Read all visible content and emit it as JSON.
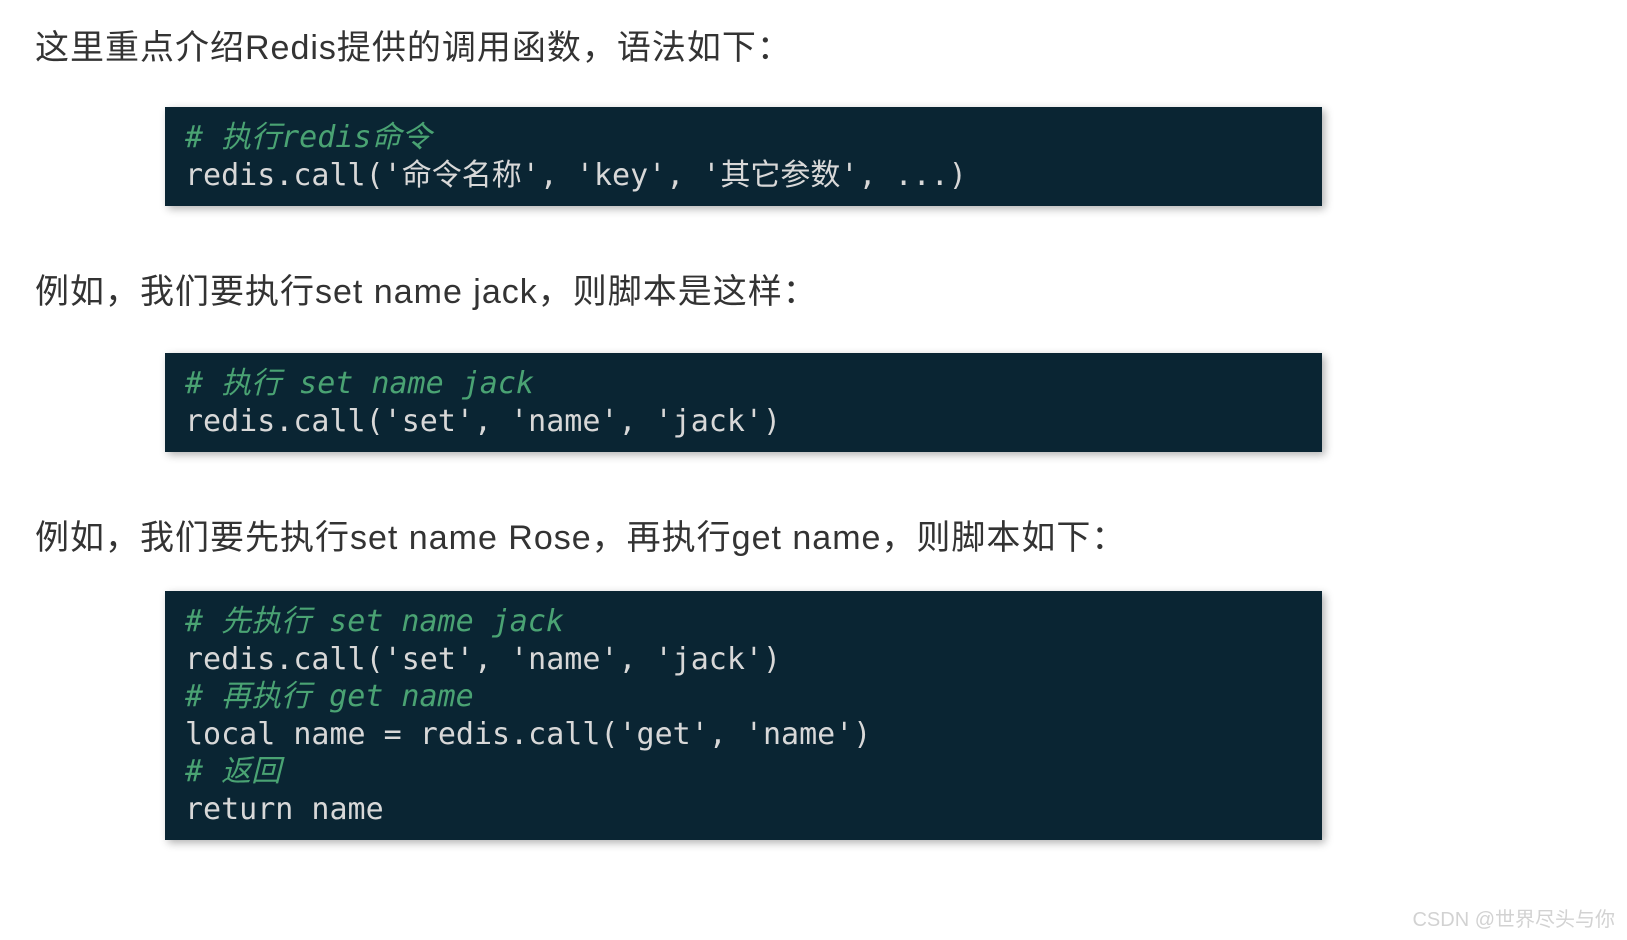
{
  "intro1": "这里重点介绍Redis提供的调用函数，语法如下：",
  "block1": {
    "comment": "# 执行redis命令",
    "code": "redis.call('命令名称', 'key', '其它参数', ...)"
  },
  "intro2": "例如，我们要执行set name jack，则脚本是这样：",
  "block2": {
    "comment": "# 执行 set name jack",
    "code": "redis.call('set', 'name', 'jack')"
  },
  "intro3": "例如，我们要先执行set name Rose，再执行get name，则脚本如下：",
  "block3": {
    "comment1": "# 先执行 set name jack",
    "code1": "redis.call('set', 'name', 'jack')",
    "comment2": "# 再执行 get name",
    "code2": "local name = redis.call('get', 'name')",
    "comment3": "# 返回",
    "code3": "return name"
  },
  "watermark": "CSDN @世界尽头与你"
}
